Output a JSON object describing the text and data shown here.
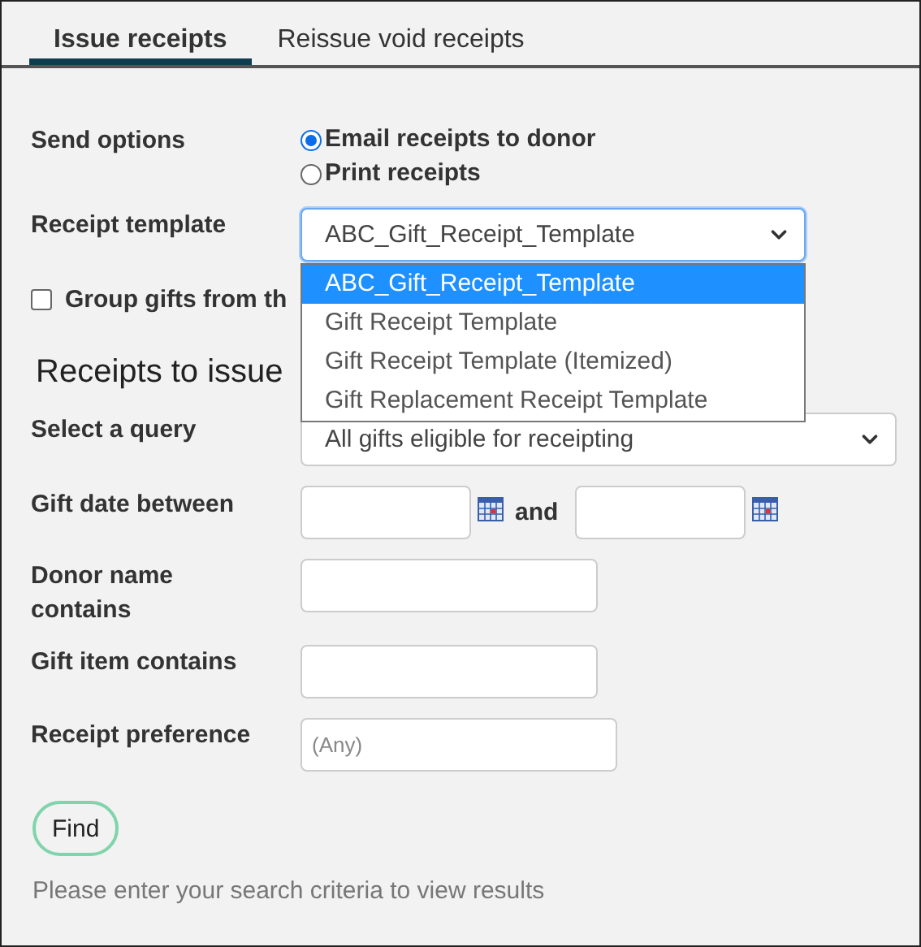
{
  "tabs": [
    {
      "label": "Issue receipts",
      "selected": true
    },
    {
      "label": "Reissue void receipts",
      "selected": false
    }
  ],
  "send_options": {
    "label": "Send options",
    "options": [
      {
        "label": "Email receipts to donor",
        "selected": true
      },
      {
        "label": "Print receipts",
        "selected": false
      }
    ]
  },
  "receipt_template": {
    "label": "Receipt template",
    "value": "ABC_Gift_Receipt_Template",
    "expanded": true,
    "options": [
      {
        "label": "ABC_Gift_Receipt_Template",
        "selected": true
      },
      {
        "label": "Gift Receipt Template",
        "selected": false
      },
      {
        "label": "Gift Receipt Template (Itemized)",
        "selected": false
      },
      {
        "label": "Gift Replacement Receipt Template",
        "selected": false
      }
    ]
  },
  "group_gifts": {
    "label": "Group gifts from th",
    "checked": false
  },
  "section_heading": "Receipts to issue",
  "query": {
    "label": "Select a query",
    "value": "All gifts eligible for receipting"
  },
  "gift_date": {
    "label": "Gift date between",
    "connector": "and"
  },
  "donor_name": {
    "label": "Donor name contains"
  },
  "gift_item": {
    "label": "Gift item contains"
  },
  "receipt_preference": {
    "label": "Receipt preference",
    "placeholder": "(Any)"
  },
  "find_button": "Find",
  "help_text": "Please enter your search criteria to view results"
}
